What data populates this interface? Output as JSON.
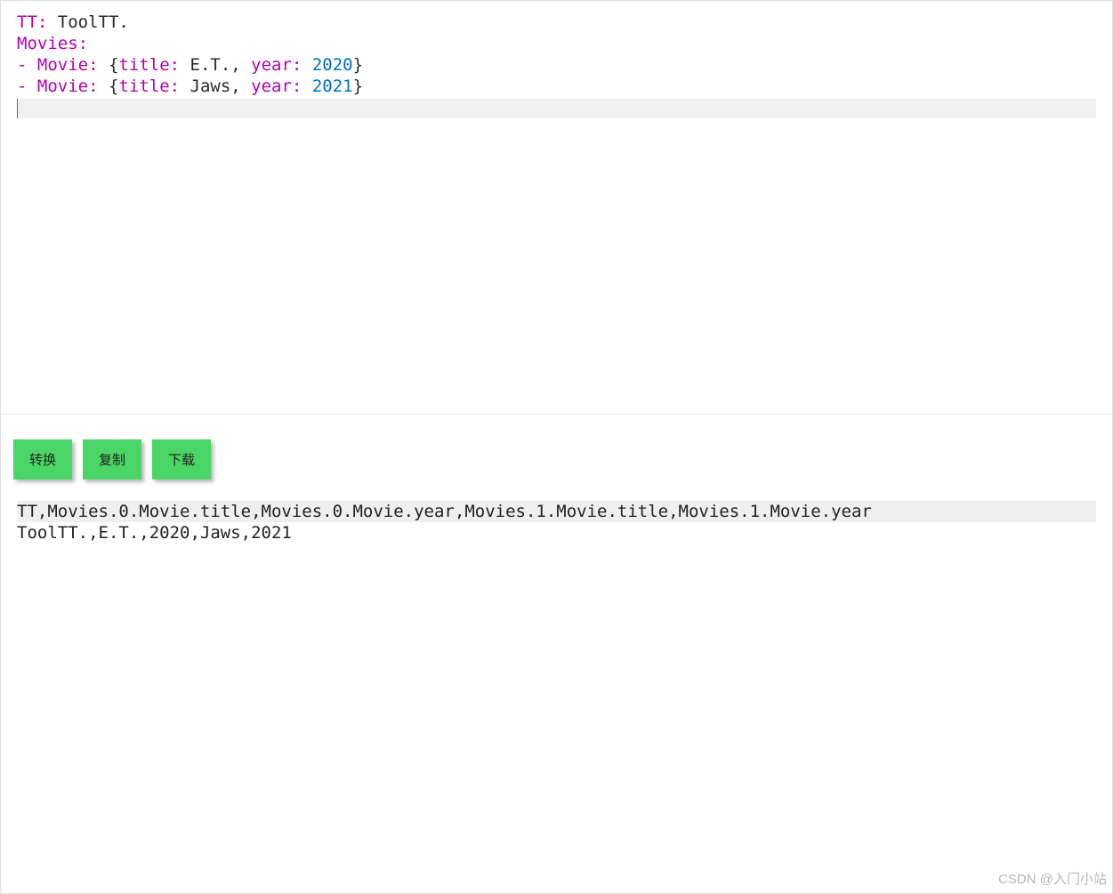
{
  "editor": {
    "lines": [
      {
        "tokens": [
          {
            "cls": "tok-key",
            "text": "TT:"
          },
          {
            "cls": "tok-plain",
            "text": " ToolTT."
          }
        ]
      },
      {
        "tokens": [
          {
            "cls": "tok-key",
            "text": "Movies:"
          }
        ]
      },
      {
        "tokens": [
          {
            "cls": "tok-dash",
            "text": "- "
          },
          {
            "cls": "tok-key",
            "text": "Movie:"
          },
          {
            "cls": "tok-plain",
            "text": " "
          },
          {
            "cls": "tok-brace",
            "text": "{"
          },
          {
            "cls": "tok-key",
            "text": "title:"
          },
          {
            "cls": "tok-plain",
            "text": " E.T., "
          },
          {
            "cls": "tok-key",
            "text": "year:"
          },
          {
            "cls": "tok-plain",
            "text": " "
          },
          {
            "cls": "tok-num",
            "text": "2020"
          },
          {
            "cls": "tok-brace",
            "text": "}"
          }
        ]
      },
      {
        "tokens": [
          {
            "cls": "tok-dash",
            "text": "- "
          },
          {
            "cls": "tok-key",
            "text": "Movie:"
          },
          {
            "cls": "tok-plain",
            "text": " "
          },
          {
            "cls": "tok-brace",
            "text": "{"
          },
          {
            "cls": "tok-key",
            "text": "title:"
          },
          {
            "cls": "tok-plain",
            "text": " Jaws, "
          },
          {
            "cls": "tok-key",
            "text": "year:"
          },
          {
            "cls": "tok-plain",
            "text": " "
          },
          {
            "cls": "tok-num",
            "text": "2021"
          },
          {
            "cls": "tok-brace",
            "text": "}"
          }
        ]
      }
    ]
  },
  "toolbar": {
    "convert_label": "转换",
    "copy_label": "复制",
    "download_label": "下载"
  },
  "output": {
    "header": "TT,Movies.0.Movie.title,Movies.0.Movie.year,Movies.1.Movie.title,Movies.1.Movie.year",
    "row": "ToolTT.,E.T.,2020,Jaws,2021"
  },
  "watermark": "CSDN @入门小站"
}
